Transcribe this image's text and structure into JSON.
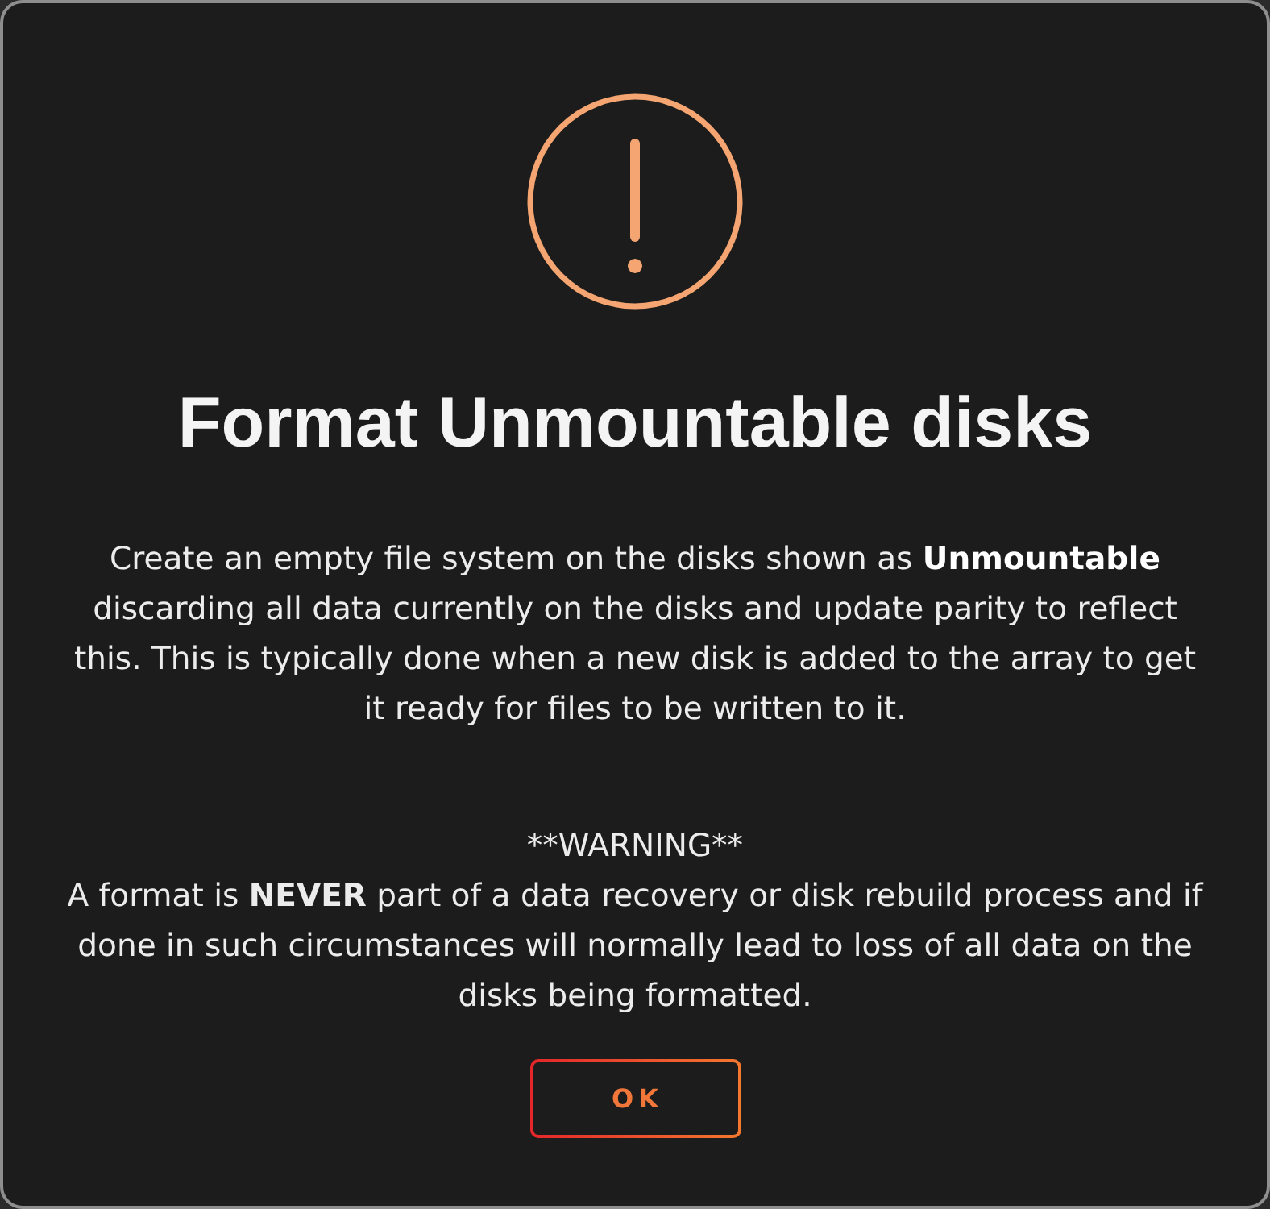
{
  "dialog": {
    "title": "Format Unmountable disks",
    "description": "Create an empty file system on the disks shown as **Unmountable** discarding all data currently on the disks and update parity to reflect this. This is typically done when a new disk is added to the array to get it ready for files to be written to it.",
    "warning_heading": "**WARNING**",
    "warning_text": "A format is **NEVER** part of a data recovery or disk rebuild process and if done in such circumstances will normally lead to loss of all data on the disks being formatted.",
    "buttons": [
      {
        "label": "OK"
      }
    ]
  }
}
